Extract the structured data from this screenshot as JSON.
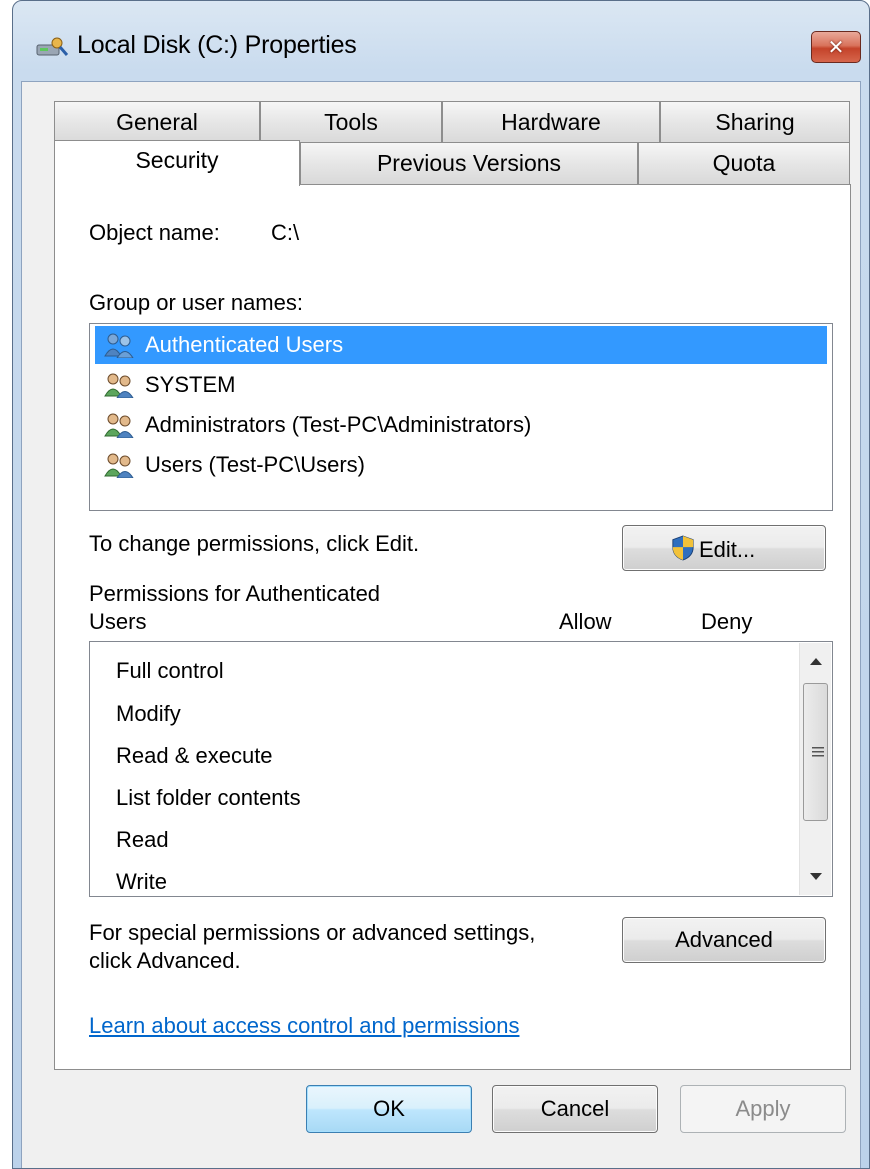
{
  "window": {
    "title": "Local Disk (C:) Properties",
    "close_symbol": "✕"
  },
  "tabs": {
    "row1": [
      "General",
      "Tools",
      "Hardware",
      "Sharing"
    ],
    "row2": [
      "Security",
      "Previous Versions",
      "Quota"
    ],
    "active": "Security"
  },
  "security": {
    "object_label": "Object name:",
    "object_value": "C:\\",
    "group_label": "Group or user names:",
    "groups": [
      {
        "name": "Authenticated Users",
        "selected": true
      },
      {
        "name": "SYSTEM",
        "selected": false
      },
      {
        "name": "Administrators (Test-PC\\Administrators)",
        "selected": false
      },
      {
        "name": "Users (Test-PC\\Users)",
        "selected": false
      }
    ],
    "change_text": "To change permissions, click Edit.",
    "edit_button": "Edit...",
    "perm_label_line1": "Permissions for Authenticated",
    "perm_label_line2": "Users",
    "allow_header": "Allow",
    "deny_header": "Deny",
    "permissions": [
      "Full control",
      "Modify",
      "Read & execute",
      "List folder contents",
      "Read",
      "Write"
    ],
    "special_line1": "For special permissions or advanced settings,",
    "special_line2": "click Advanced.",
    "advanced_button": "Advanced",
    "learn_link": "Learn about access control and permissions"
  },
  "footer": {
    "ok": "OK",
    "cancel": "Cancel",
    "apply": "Apply"
  },
  "colors": {
    "selection": "#3399ff",
    "link": "#0066cc",
    "close_button": "#c4432a"
  }
}
